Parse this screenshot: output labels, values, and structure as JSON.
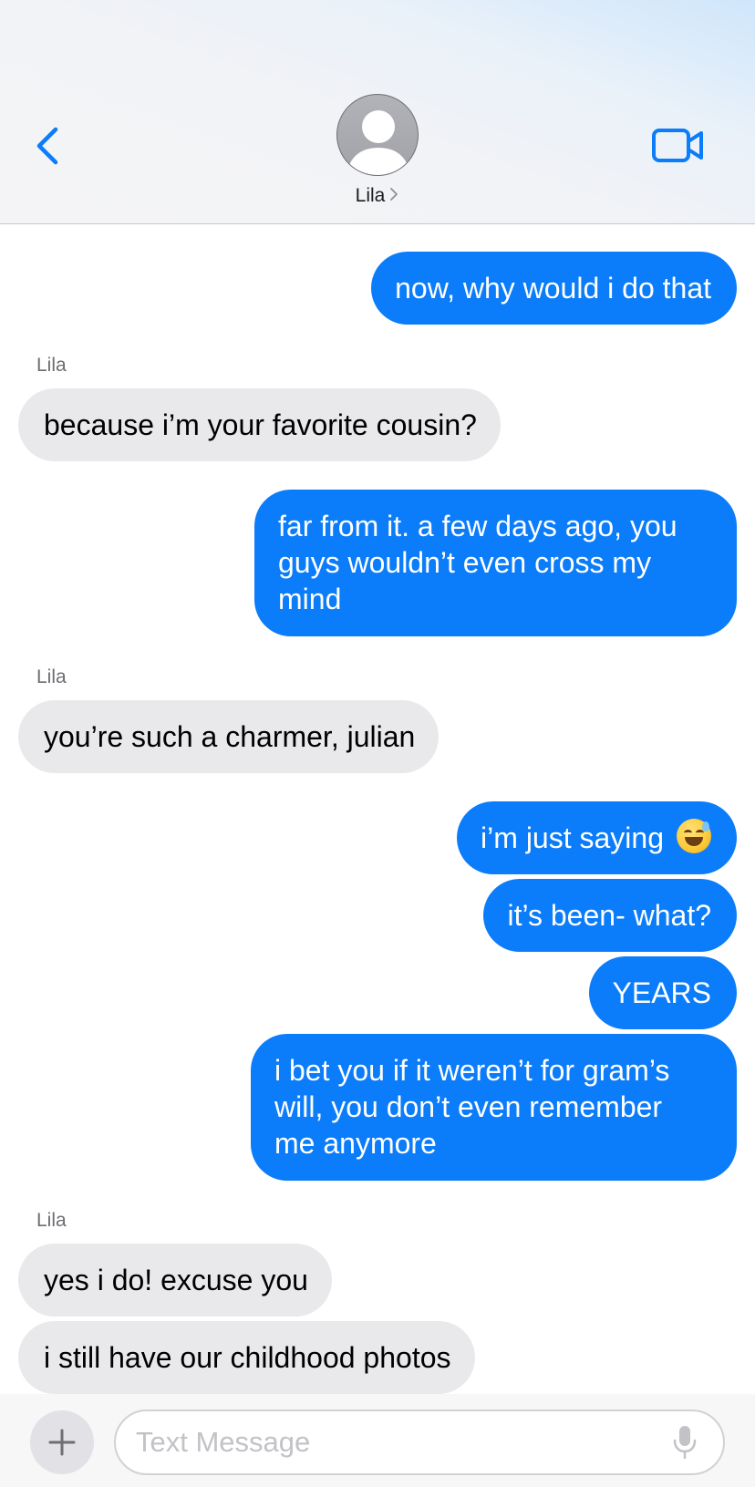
{
  "header": {
    "contact_name": "Lila",
    "accent_color": "#0b7cfa"
  },
  "icons": {
    "back": "chevron-left-icon",
    "video": "video-camera-icon",
    "add": "plus-icon",
    "mic": "microphone-icon",
    "avatar": "person-silhouette-icon"
  },
  "messages": [
    {
      "direction": "sent",
      "text": "now, why would i do that"
    },
    {
      "direction": "received",
      "sender": "Lila",
      "text": "because i’m your favorite cousin?"
    },
    {
      "direction": "sent",
      "lines": [
        "far from it. a few days ago, you",
        "guys wouldn’t even cross my",
        "mind"
      ]
    },
    {
      "direction": "received",
      "sender": "Lila",
      "text": "you’re such a charmer, julian"
    },
    {
      "direction": "sent",
      "text": "i’m just saying",
      "emoji": "grinning-face-with-sweat"
    },
    {
      "direction": "sent",
      "text": "it’s been- what?"
    },
    {
      "direction": "sent",
      "text": "YEARS"
    },
    {
      "direction": "sent",
      "lines": [
        "i bet you if it weren’t for gram’s",
        "will, you don’t even remember",
        "me anymore"
      ]
    },
    {
      "direction": "received",
      "sender": "Lila",
      "text": "yes i do! excuse you"
    },
    {
      "direction": "received",
      "text": "i still have our childhood photos"
    }
  ],
  "input": {
    "value": "",
    "placeholder": "Text Message"
  }
}
